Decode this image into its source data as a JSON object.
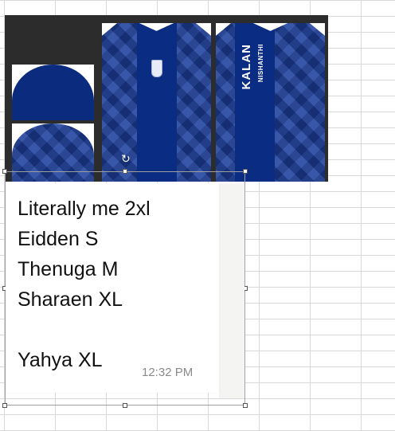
{
  "spreadsheet": {
    "gridline_color": "#d9d9d9"
  },
  "jersey_mockup": {
    "background": "#2c2c2c",
    "jersey_color": "#1c3f9d",
    "back_name": "KALAN",
    "back_subtext": "NISHANTHI",
    "rotate_icon": "↻"
  },
  "chat_message": {
    "lines": [
      "Literally me 2xl",
      "Eidden S",
      "Thenuga M",
      "Sharaen XL",
      "Yahya XL"
    ],
    "timestamp": "12:32 PM"
  }
}
